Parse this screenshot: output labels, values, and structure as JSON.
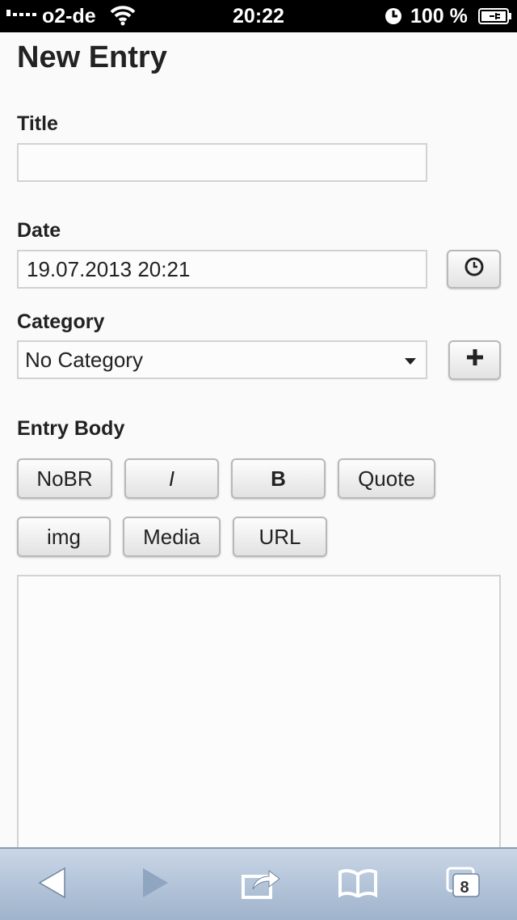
{
  "status_bar": {
    "carrier": "o2-de",
    "time": "20:22",
    "battery": "100 %"
  },
  "page": {
    "title": "New Entry"
  },
  "form": {
    "title_label": "Title",
    "title_value": "",
    "date_label": "Date",
    "date_value": "19.07.2013 20:21",
    "category_label": "Category",
    "category_selected": "No Category",
    "body_label": "Entry Body",
    "body_value": ""
  },
  "formatting_buttons": {
    "nobr": "NoBR",
    "italic": "I",
    "bold": "B",
    "quote": "Quote",
    "img": "img",
    "media": "Media",
    "url": "URL"
  },
  "toolbar": {
    "tab_count": "8",
    "icons": [
      "back-icon",
      "forward-icon",
      "share-icon",
      "bookmarks-icon",
      "tabs-icon"
    ]
  },
  "colors": {
    "toolbar_top": "#c9d6e6",
    "toolbar_bottom": "#9fb3cc",
    "status_bar": "#000000",
    "forward_disabled": "#8fa5c0"
  }
}
